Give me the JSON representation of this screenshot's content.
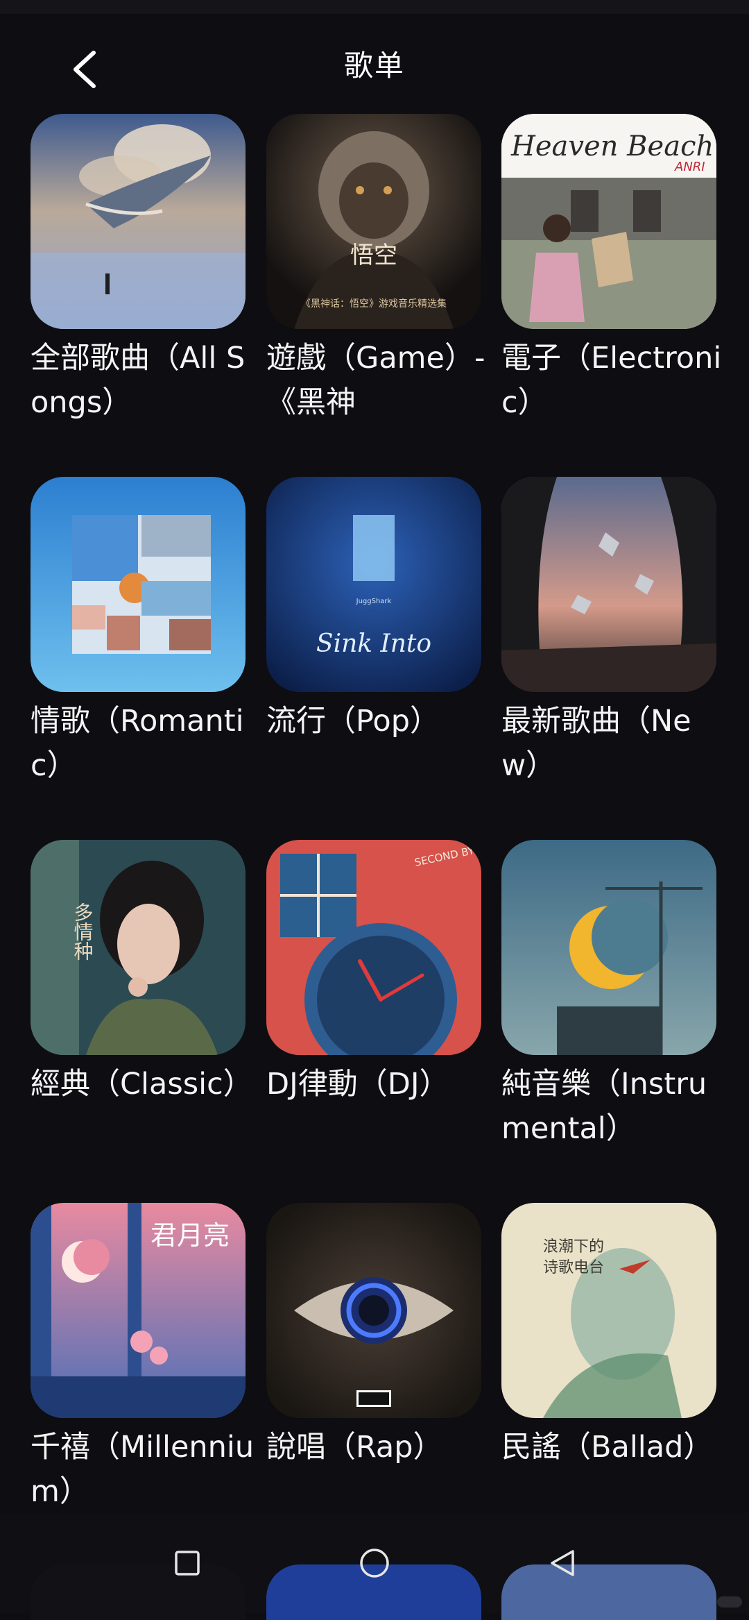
{
  "header": {
    "title": "歌单",
    "back_icon": "chevron-left-icon"
  },
  "playlists": [
    {
      "title": "全部歌曲（All Songs）",
      "cover": "whale-sky"
    },
    {
      "title": "遊戲（Game）-《黑神",
      "cover": "wukong"
    },
    {
      "title": "電子（Electronic）",
      "cover": "heaven-beach"
    },
    {
      "title": "情歌（Romantic）",
      "cover": "collage-sky"
    },
    {
      "title": "流行（Pop）",
      "cover": "sink-into"
    },
    {
      "title": "最新歌曲（New）",
      "cover": "cave-sunset"
    },
    {
      "title": "經典（Classic）",
      "cover": "vintage-portrait"
    },
    {
      "title": "DJ律動（DJ）",
      "cover": "clock"
    },
    {
      "title": "純音樂（Instrumental）",
      "cover": "crescent-moon"
    },
    {
      "title": "千禧（Millennium）",
      "cover": "moon-window"
    },
    {
      "title": "說唱（Rap）",
      "cover": "gas-eye"
    },
    {
      "title": "民謠（Ballad）",
      "cover": "poetry-radio"
    }
  ],
  "cover_text": {
    "wukong_title": "悟空",
    "wukong_caption": "《黑神话：悟空》游戏音乐精选集",
    "heaven_beach": "Heaven Beach",
    "anri": "ANRI",
    "sink_into": "Sink Into",
    "sink_small": "JuggShark",
    "vintage_title": "多情种",
    "poetry_1": "浪潮下的",
    "poetry_2": "诗歌电台",
    "millennium_title": "君月亮",
    "clock_text": "SECOND BY SECOND 秒针"
  },
  "nav": {
    "recents": "square-icon",
    "home": "circle-icon",
    "back": "triangle-back-icon"
  }
}
